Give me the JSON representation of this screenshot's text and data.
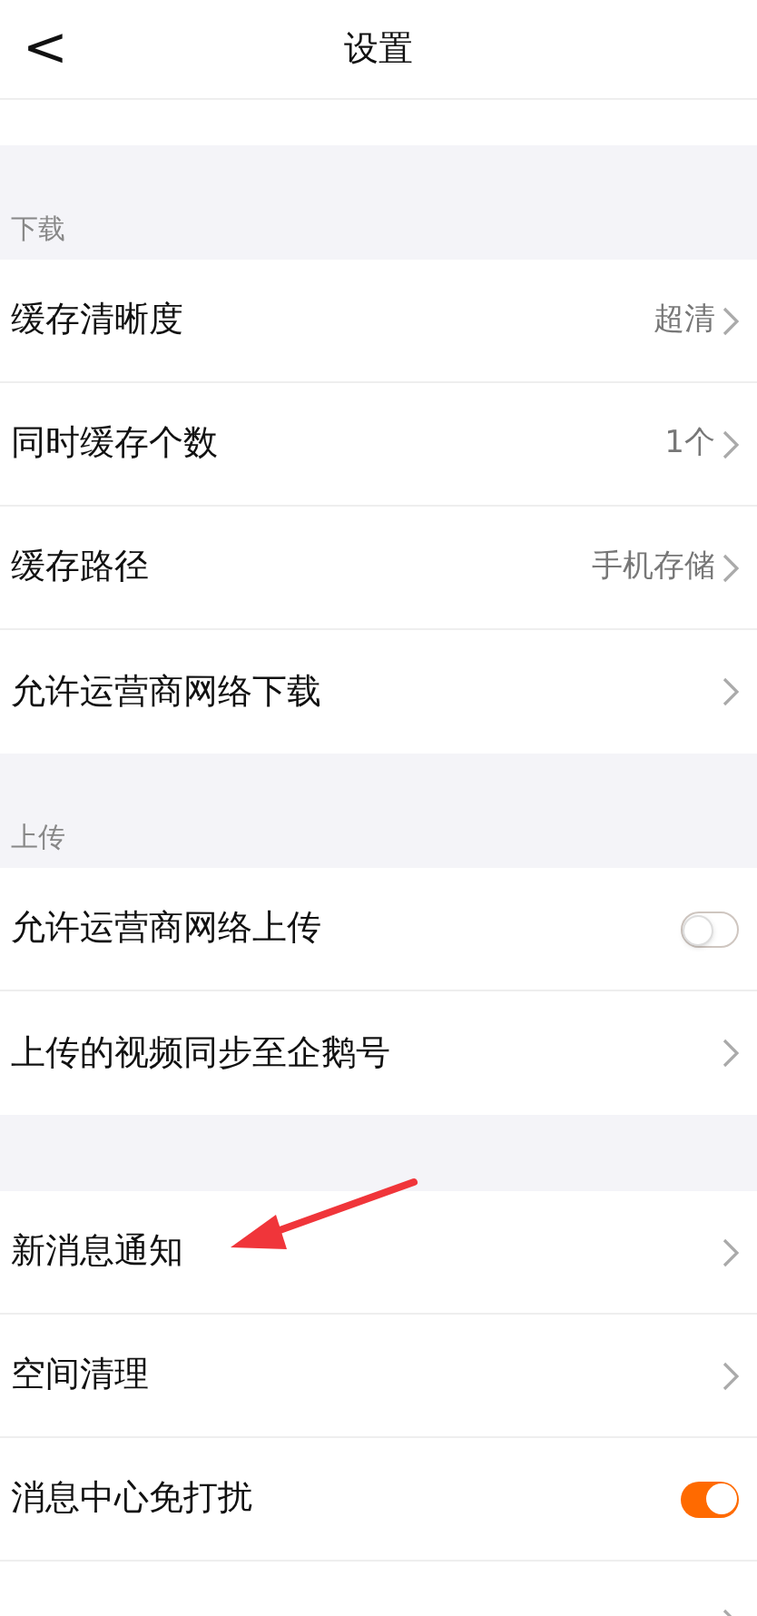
{
  "nav": {
    "back": "<",
    "title": "设置"
  },
  "sections": [
    {
      "header": "下载",
      "rows": [
        {
          "kind": "link",
          "label": "缓存清晰度",
          "value": "超清"
        },
        {
          "kind": "link",
          "label": "同时缓存个数",
          "value": "1个"
        },
        {
          "kind": "link",
          "label": "缓存路径",
          "value": "手机存储"
        },
        {
          "kind": "link",
          "label": "允许运营商网络下载"
        }
      ]
    },
    {
      "header": "上传",
      "rows": [
        {
          "kind": "toggle",
          "label": "允许运营商网络上传",
          "on": false
        },
        {
          "kind": "link",
          "label": "上传的视频同步至企鹅号"
        }
      ]
    },
    {
      "rows": [
        {
          "kind": "link",
          "label": "新消息通知"
        },
        {
          "kind": "link",
          "label": "空间清理"
        },
        {
          "kind": "toggle",
          "label": "消息中心免打扰",
          "on": true
        },
        {
          "kind": "link"
        }
      ]
    }
  ]
}
